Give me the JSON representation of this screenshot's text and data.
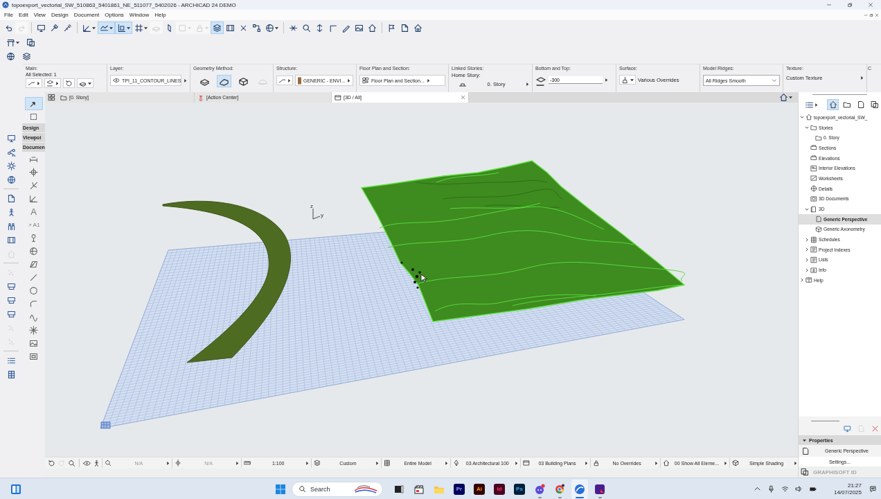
{
  "window": {
    "title": "topoexport_vectorial_SW_510863_5401861_NE_511077_5402026 - ARCHICAD 24 DEMO"
  },
  "menu": [
    "File",
    "Edit",
    "View",
    "Design",
    "Document",
    "Options",
    "Window",
    "Help"
  ],
  "toolbar": [
    {
      "on": false,
      "disabled": false
    },
    {
      "on": false,
      "disabled": true
    },
    {
      "on": false,
      "disabled": false
    },
    {
      "on": false,
      "disabled": false
    },
    {
      "on": false,
      "disabled": false
    },
    {
      "on": false,
      "disabled": false
    },
    {
      "on": true,
      "disabled": false
    },
    {
      "on": true,
      "disabled": false
    },
    {
      "on": false,
      "disabled": false
    },
    {
      "on": false,
      "disabled": true
    },
    {
      "on": false,
      "disabled": false
    },
    {
      "on": false,
      "disabled": true
    },
    {
      "on": false,
      "disabled": true
    },
    {
      "on": true,
      "disabled": false
    },
    {
      "on": false,
      "disabled": false
    },
    {
      "on": false,
      "disabled": false
    },
    {
      "on": false,
      "disabled": false
    },
    {
      "on": false,
      "disabled": false
    },
    {
      "on": false,
      "disabled": false
    },
    {
      "on": false,
      "disabled": false
    },
    {
      "on": false,
      "disabled": false
    },
    {
      "on": false,
      "disabled": false
    },
    {
      "on": false,
      "disabled": false
    },
    {
      "on": false,
      "disabled": false
    },
    {
      "on": false,
      "disabled": false
    },
    {
      "on": false,
      "disabled": false
    },
    {
      "on": false,
      "disabled": false
    },
    {
      "on": false,
      "disabled": false
    }
  ],
  "info_box": {
    "main": {
      "label": "Main:",
      "selection": "All Selected: 1"
    },
    "layer": {
      "label": "Layer:",
      "value": "TPI_11_CONTOUR_LINES"
    },
    "geometry_method": {
      "label": "Geometry Method:",
      "options": [
        {
          "selected": false,
          "disabled": false
        },
        {
          "selected": true,
          "disabled": false
        },
        {
          "selected": false,
          "disabled": false
        },
        {
          "selected": false,
          "disabled": true
        }
      ]
    },
    "structure": {
      "label": "Structure:",
      "value": "GENERIC - ENVI..."
    },
    "floor_plan": {
      "label": "Floor Plan and Section:",
      "value": "Floor Plan and Section..."
    },
    "linked_stories": {
      "label": "Linked Stories:",
      "home_story_label": "Home Story:",
      "home_story": "0. Story"
    },
    "bottom_and_top": {
      "label": "Bottom and Top:",
      "value": "-300"
    },
    "surface": {
      "label": "Surface:",
      "value": "Various Overrides"
    },
    "model_ridges": {
      "label": "Model Ridges:",
      "value": "All Ridges Smooth"
    },
    "texture": {
      "label": "Texture:",
      "value": "Custom Texture"
    },
    "column_11": {
      "label": "C"
    }
  },
  "tabs": [
    {
      "label": "[0. Story]",
      "selected": false
    },
    {
      "label": "[Action Center]",
      "selected": false
    },
    {
      "label": "[3D / All]",
      "selected": true
    }
  ],
  "side_toolbar": [
    {
      "disabled": false
    },
    {
      "disabled": false
    },
    {
      "disabled": false
    },
    {
      "disabled": false
    },
    {
      "disabled": false
    },
    {
      "disabled": false
    },
    {
      "disabled": false
    },
    {
      "disabled": false
    },
    {
      "disabled": true
    },
    {
      "disabled": true
    },
    {
      "disabled": false
    },
    {
      "disabled": false
    },
    {
      "disabled": false
    },
    {
      "disabled": true
    },
    {
      "disabled": true
    },
    {
      "disabled": false
    },
    {
      "disabled": false
    }
  ],
  "toolbox": {
    "tools": [
      {
        "selected": true
      },
      {
        "selected": false
      }
    ],
    "palettes": [
      "Design",
      "Viewpoi",
      "Documen"
    ],
    "text_tool": "A",
    "label_tool": "A1"
  },
  "viewport": {
    "axis_labels": [
      "z",
      "y"
    ]
  },
  "navigator": {
    "views": [
      {
        "selected": true
      },
      {
        "selected": false
      },
      {
        "selected": false
      },
      {
        "selected": false
      }
    ],
    "tree": [
      {
        "label": "topoexport_vectorial_SW_",
        "kind": "project",
        "expanded": true,
        "selected": false,
        "children": [
          {
            "label": "Stories",
            "kind": "stories",
            "expanded": true,
            "selected": false,
            "children": [
              {
                "label": "0. Story",
                "kind": "story",
                "selected": false
              }
            ]
          },
          {
            "label": "Sections",
            "kind": "sections",
            "selected": false
          },
          {
            "label": "Elevations",
            "kind": "elevations",
            "selected": false
          },
          {
            "label": "Interior Elevations",
            "kind": "interiors",
            "selected": false
          },
          {
            "label": "Worksheets",
            "kind": "worksheets",
            "selected": false
          },
          {
            "label": "Details",
            "kind": "details",
            "selected": false
          },
          {
            "label": "3D Documents",
            "kind": "documents",
            "selected": false
          },
          {
            "label": "3D",
            "kind": "model",
            "expanded": true,
            "selected": false,
            "children": [
              {
                "label": "Generic Perspective",
                "kind": "perspective",
                "selected": true
              },
              {
                "label": "Generic Axonometry",
                "kind": "axonometry",
                "selected": false
              }
            ]
          },
          {
            "label": "Schedules",
            "kind": "schedules",
            "expanded": false,
            "selected": false
          },
          {
            "label": "Project Indexes",
            "kind": "indexes",
            "expanded": false,
            "selected": false
          },
          {
            "label": "Lists",
            "kind": "lists",
            "expanded": false,
            "selected": false
          },
          {
            "label": "Info",
            "kind": "info",
            "expanded": false,
            "selected": false
          }
        ]
      },
      {
        "label": "Help",
        "kind": "help",
        "expanded": false,
        "selected": false
      }
    ],
    "actions": [
      {
        "disabled": false
      },
      {
        "disabled": true
      },
      {
        "disabled": false
      }
    ]
  },
  "properties": {
    "title": "Properties",
    "expanded": true,
    "view": "Generic Perspective",
    "button": "Settings..."
  },
  "account": {
    "label": "GRAPHISOFT ID"
  },
  "status_bar": {
    "controls": [
      {
        "disabled": false
      },
      {
        "disabled": true
      },
      {
        "disabled": false
      },
      {
        "disabled": false
      },
      {
        "disabled": false
      }
    ],
    "items": [
      {
        "value": "N/A",
        "disabled": true
      },
      {
        "value": "N/A",
        "disabled": true
      },
      {
        "value": "1:100",
        "disabled": false
      },
      {
        "value": "Custom",
        "disabled": false
      },
      {
        "value": "Entire Model",
        "disabled": false
      },
      {
        "value": "03 Architectural 100",
        "disabled": false
      },
      {
        "value": "03 Building Plans",
        "disabled": false
      },
      {
        "value": "No Overrides",
        "disabled": false
      },
      {
        "value": "00 Show All Eleme...",
        "disabled": false
      },
      {
        "value": "Simple Shading",
        "disabled": false
      }
    ]
  },
  "taskbar": {
    "search": {
      "placeholder": "Search"
    },
    "apps": [
      {
        "running": false,
        "active": false
      },
      {
        "running": false,
        "active": false
      },
      {
        "running": false,
        "active": false
      },
      {
        "label": "Pr",
        "running": false,
        "active": false
      },
      {
        "label": "Ai",
        "running": false,
        "active": false
      },
      {
        "label": "Id",
        "running": false,
        "active": false
      },
      {
        "label": "Ps",
        "running": false,
        "active": false
      },
      {
        "running": true,
        "active": false
      },
      {
        "running": true,
        "active": false
      },
      {
        "running": true,
        "active": true
      },
      {
        "running": true,
        "active": false
      }
    ],
    "clock": {
      "time": "21:27",
      "date": "14/07/2025"
    }
  }
}
